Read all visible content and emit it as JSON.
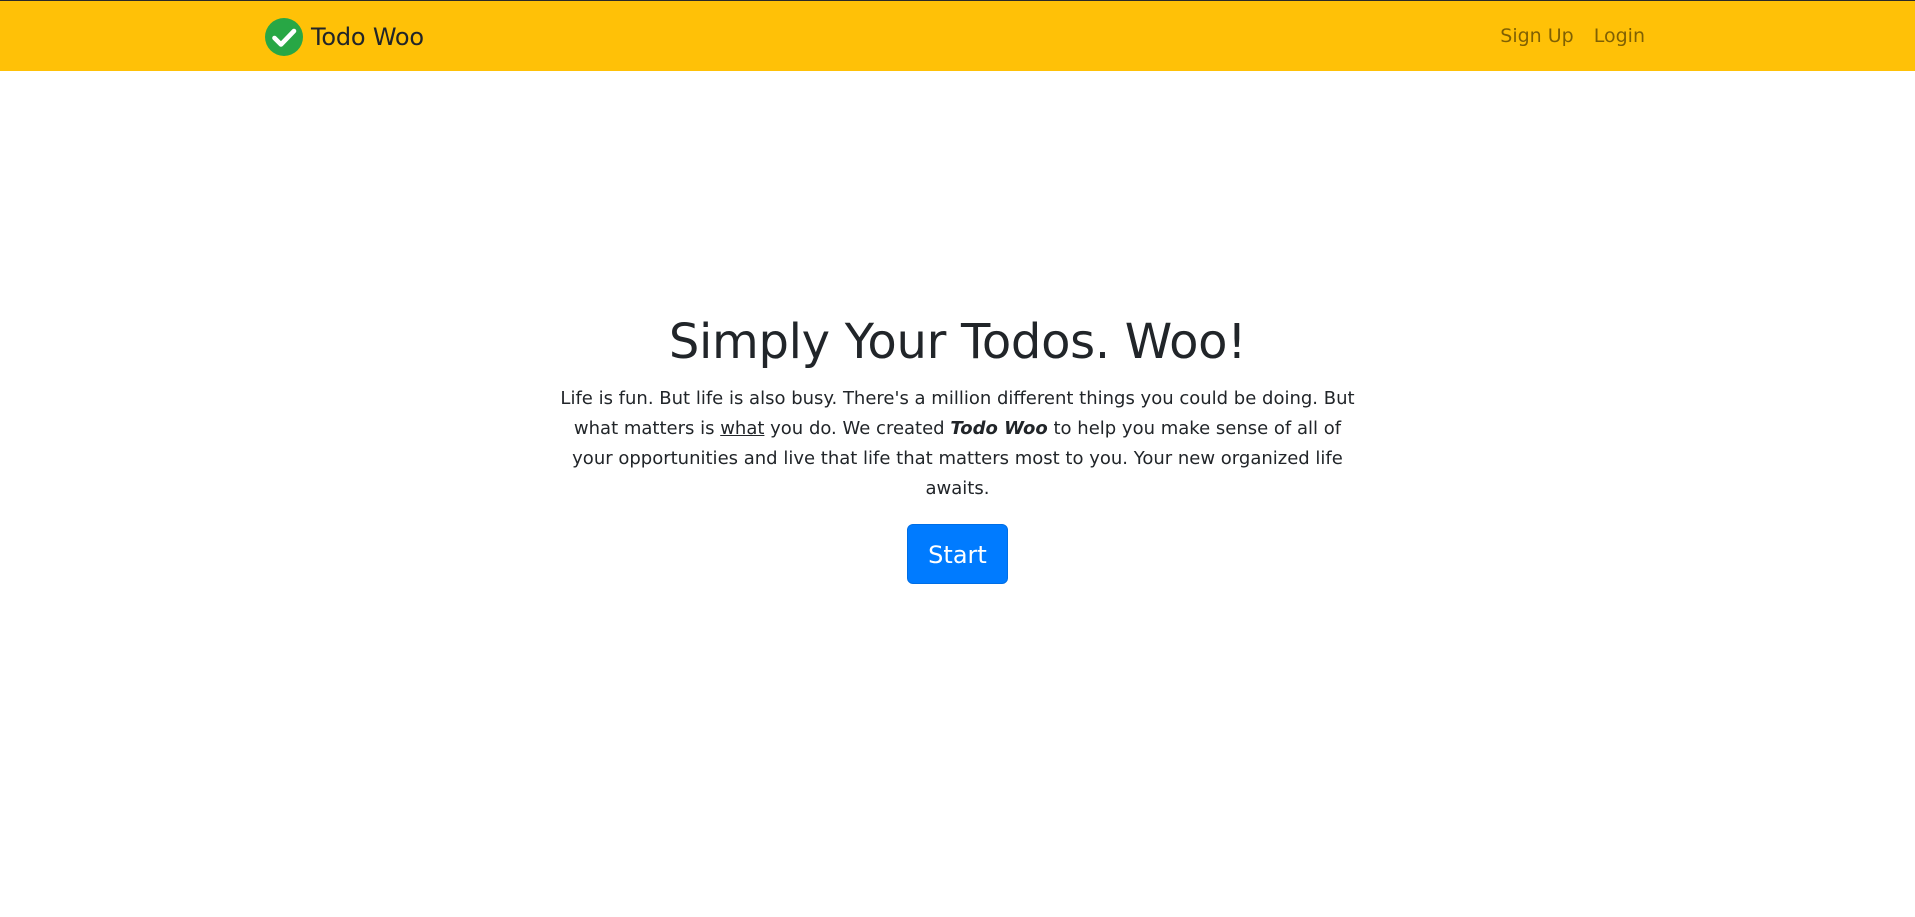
{
  "navbar": {
    "brand_name": "Todo Woo",
    "brand_icon": "check-circle-icon",
    "sign_up_label": "Sign Up",
    "login_label": "Login",
    "background_color": "#ffc107"
  },
  "hero": {
    "title": "Simply Your Todos. Woo!",
    "paragraph": {
      "part1": "Life is fun. But life is also busy. There's a million different things you could be doing. But what matters is ",
      "underlined": "what",
      "part2": " you do. We created ",
      "emphasis": "Todo Woo",
      "part3": " to help you make sense of all of your opportunities and live that life that matters most to you. Your new organized life awaits."
    },
    "start_label": "Start",
    "button_color": "#007bff"
  }
}
